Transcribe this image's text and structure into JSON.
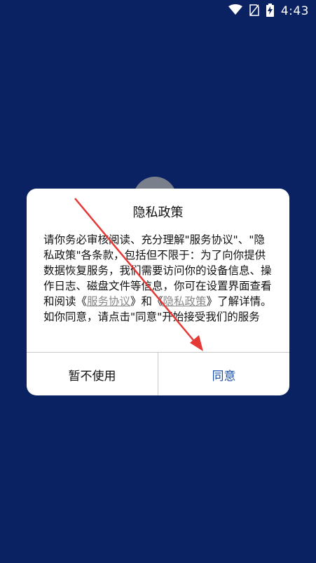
{
  "status_bar": {
    "time": "4:43",
    "icons": [
      "wifi-icon",
      "no-sim-icon",
      "battery-charging-icon"
    ]
  },
  "dialog": {
    "title": "隐私政策",
    "body": {
      "intro": "请你务必审核阅读、充分理解\"服务协议\"、\"隐私政策\"各条款，包括但不限于：为了向你提供数据恢复服务，我们需要访问你的设备信息、操作日志、磁盘文件等信息，你可在设置界面查看和阅读《",
      "link_service": "服务协议",
      "between": "》和《",
      "link_privacy": "隐私政策",
      "outro": "》了解详情。如你同意，请点击\"同意\"开始接受我们的服务"
    },
    "decline_label": "暂不使用",
    "agree_label": "同意"
  },
  "colors": {
    "background": "#0b2262",
    "agree": "#1a4fa8",
    "annotation_arrow": "#e53935"
  }
}
